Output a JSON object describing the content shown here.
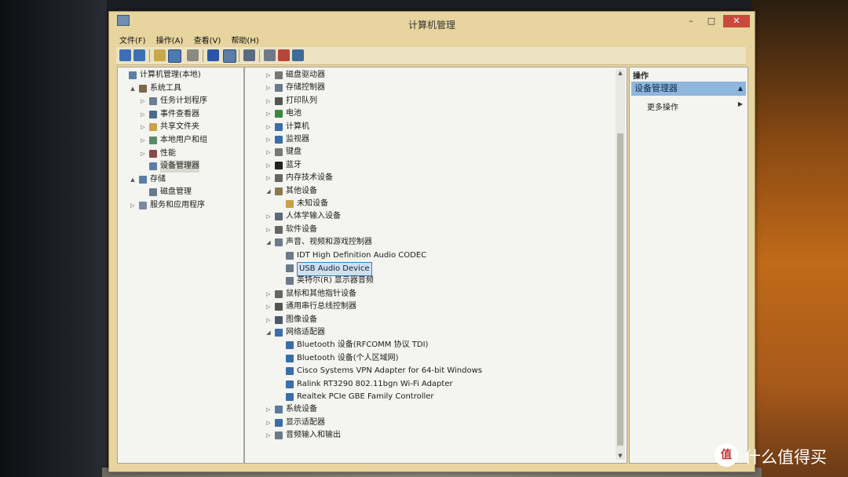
{
  "window": {
    "title": "计算机管理"
  },
  "menu": [
    "文件(F)",
    "操作(A)",
    "查看(V)",
    "帮助(H)"
  ],
  "tree": [
    {
      "label": "计算机管理(本地)",
      "icon": "computer-management-icon",
      "level": 0,
      "arrow": ""
    },
    {
      "label": "系统工具",
      "icon": "tools-icon",
      "level": 1,
      "arrow": "▲"
    },
    {
      "label": "任务计划程序",
      "icon": "clock-icon",
      "level": 2,
      "arrow": "▷"
    },
    {
      "label": "事件查看器",
      "icon": "event-viewer-icon",
      "level": 2,
      "arrow": "▷"
    },
    {
      "label": "共享文件夹",
      "icon": "shared-folder-icon",
      "level": 2,
      "arrow": "▷"
    },
    {
      "label": "本地用户和组",
      "icon": "users-icon",
      "level": 2,
      "arrow": "▷"
    },
    {
      "label": "性能",
      "icon": "performance-icon",
      "level": 2,
      "arrow": "▷"
    },
    {
      "label": "设备管理器",
      "icon": "device-manager-icon",
      "level": 2,
      "arrow": "",
      "selected": true
    },
    {
      "label": "存储",
      "icon": "storage-icon",
      "level": 1,
      "arrow": "▲"
    },
    {
      "label": "磁盘管理",
      "icon": "disk-icon",
      "level": 2,
      "arrow": ""
    },
    {
      "label": "服务和应用程序",
      "icon": "services-icon",
      "level": 1,
      "arrow": "▷"
    }
  ],
  "devices": [
    {
      "label": "磁盘驱动器",
      "icon": "disk-drive-icon",
      "level": 0,
      "arrow": "▷"
    },
    {
      "label": "存储控制器",
      "icon": "storage-controller-icon",
      "level": 0,
      "arrow": "▷"
    },
    {
      "label": "打印队列",
      "icon": "printer-icon",
      "level": 0,
      "arrow": "▷"
    },
    {
      "label": "电池",
      "icon": "battery-icon",
      "level": 0,
      "arrow": "▷"
    },
    {
      "label": "计算机",
      "icon": "computer-icon",
      "level": 0,
      "arrow": "▷"
    },
    {
      "label": "监视器",
      "icon": "monitor-icon",
      "level": 0,
      "arrow": "▷"
    },
    {
      "label": "键盘",
      "icon": "keyboard-icon",
      "level": 0,
      "arrow": "▷"
    },
    {
      "label": "蓝牙",
      "icon": "bluetooth-icon",
      "level": 0,
      "arrow": "▷"
    },
    {
      "label": "内存技术设备",
      "icon": "memory-icon",
      "level": 0,
      "arrow": "▷"
    },
    {
      "label": "其他设备",
      "icon": "other-devices-icon",
      "level": 0,
      "arrow": "◢"
    },
    {
      "label": "未知设备",
      "icon": "unknown-device-icon",
      "level": 1,
      "arrow": ""
    },
    {
      "label": "人体学输入设备",
      "icon": "hid-icon",
      "level": 0,
      "arrow": "▷"
    },
    {
      "label": "软件设备",
      "icon": "software-device-icon",
      "level": 0,
      "arrow": "▷"
    },
    {
      "label": "声音、视频和游戏控制器",
      "icon": "speaker-icon",
      "level": 0,
      "arrow": "◢"
    },
    {
      "label": "IDT High Definition Audio CODEC",
      "icon": "speaker-icon",
      "level": 1,
      "arrow": ""
    },
    {
      "label": "USB Audio Device",
      "icon": "speaker-icon",
      "level": 1,
      "arrow": "",
      "selected": true
    },
    {
      "label": "英特尔(R) 显示器音频",
      "icon": "speaker-icon",
      "level": 1,
      "arrow": ""
    },
    {
      "label": "鼠标和其他指针设备",
      "icon": "mouse-icon",
      "level": 0,
      "arrow": "▷"
    },
    {
      "label": "通用串行总线控制器",
      "icon": "usb-icon",
      "level": 0,
      "arrow": "▷"
    },
    {
      "label": "图像设备",
      "icon": "camera-icon",
      "level": 0,
      "arrow": "▷"
    },
    {
      "label": "网络适配器",
      "icon": "network-icon",
      "level": 0,
      "arrow": "◢"
    },
    {
      "label": "Bluetooth 设备(RFCOMM 协议 TDI)",
      "icon": "network-adapter-icon",
      "level": 1,
      "arrow": ""
    },
    {
      "label": "Bluetooth 设备(个人区域网)",
      "icon": "network-adapter-icon",
      "level": 1,
      "arrow": ""
    },
    {
      "label": "Cisco Systems VPN Adapter for 64-bit Windows",
      "icon": "network-adapter-icon",
      "level": 1,
      "arrow": ""
    },
    {
      "label": "Ralink RT3290 802.11bgn Wi-Fi Adapter",
      "icon": "network-adapter-icon",
      "level": 1,
      "arrow": ""
    },
    {
      "label": "Realtek PCIe GBE Family Controller",
      "icon": "network-adapter-icon",
      "level": 1,
      "arrow": ""
    },
    {
      "label": "系统设备",
      "icon": "system-device-icon",
      "level": 0,
      "arrow": "▷"
    },
    {
      "label": "显示适配器",
      "icon": "display-adapter-icon",
      "level": 0,
      "arrow": "▷"
    },
    {
      "label": "音频输入和输出",
      "icon": "audio-io-icon",
      "level": 0,
      "arrow": "▷"
    }
  ],
  "actions": {
    "header": "操作",
    "group": "设备管理器",
    "more": "更多操作"
  },
  "watermark": {
    "text": "什么值得买",
    "badge": "值"
  },
  "colors": {
    "window_frame": "#e7d49f",
    "selection": "#cde1f5",
    "selection_border": "#3a7fc8",
    "action_group": "#8fb6dc",
    "close_button": "#c94a3d"
  }
}
